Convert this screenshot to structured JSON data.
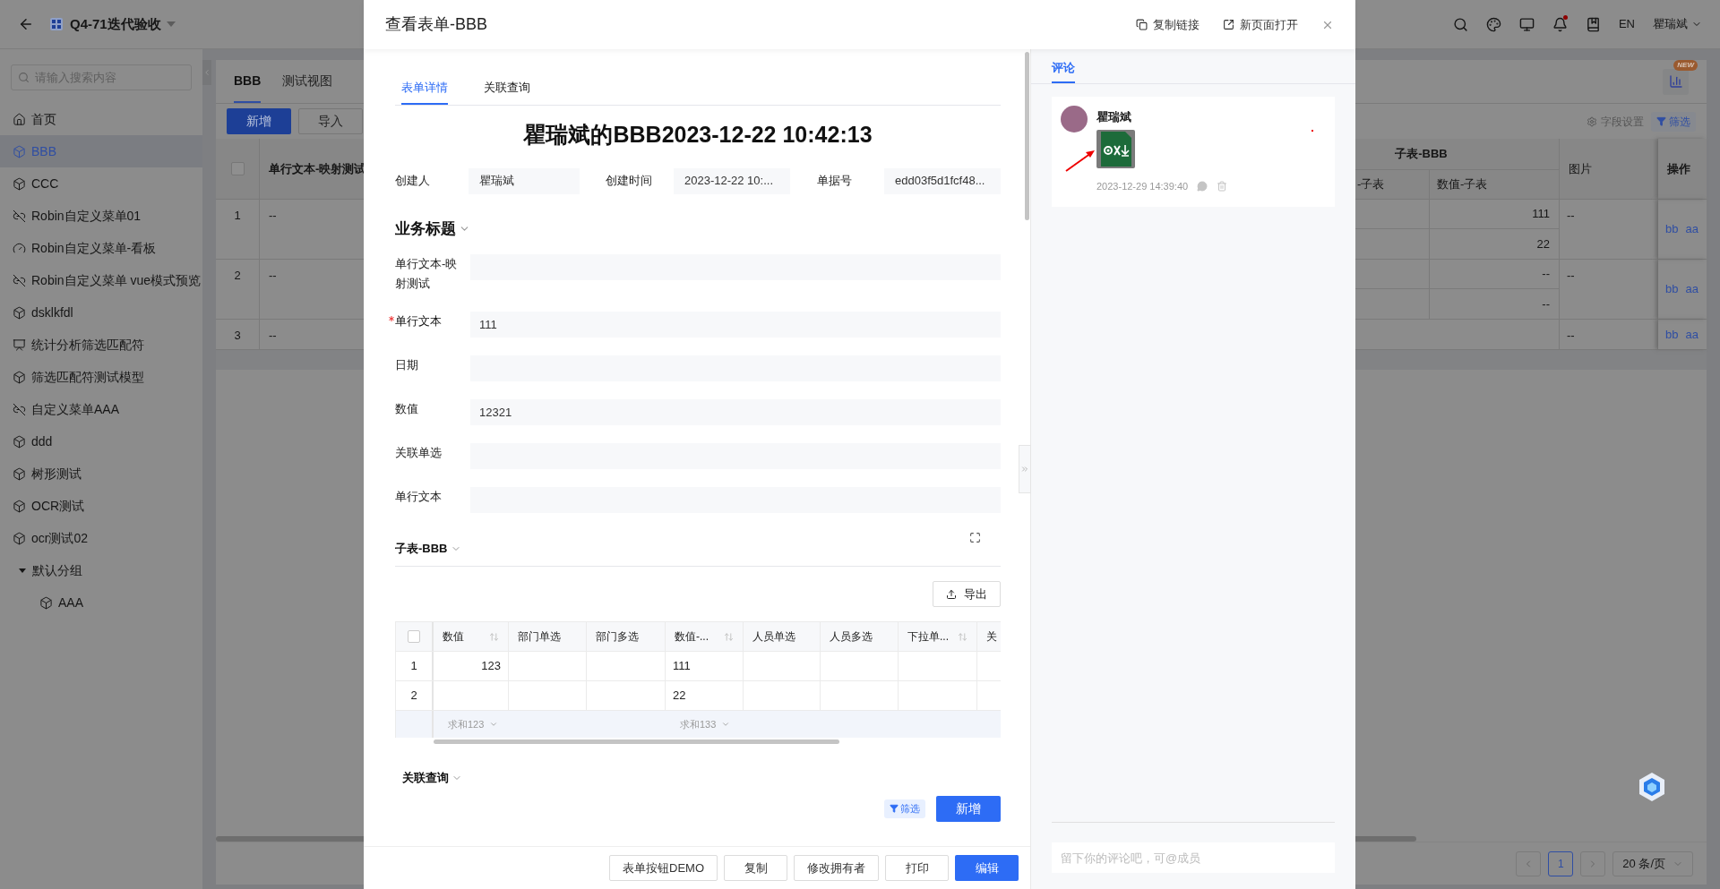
{
  "topbar": {
    "app_name": "Q4-71迭代验收",
    "notifications_unread": true,
    "language": "EN",
    "user": "瞿瑞斌"
  },
  "sidebar": {
    "search_placeholder": "请输入搜索内容",
    "items": [
      {
        "label": "首页",
        "kind": "home",
        "selected": false
      },
      {
        "label": "BBB",
        "kind": "model",
        "selected": true
      },
      {
        "label": "CCC",
        "kind": "model",
        "selected": false
      },
      {
        "label": "Robin自定义菜单01",
        "kind": "link",
        "selected": false
      },
      {
        "label": "Robin自定义菜单-看板",
        "kind": "dashboard",
        "selected": false
      },
      {
        "label": "Robin自定义菜单 vue模式预览",
        "kind": "link",
        "selected": false
      },
      {
        "label": "dsklkfdl",
        "kind": "model",
        "selected": false
      },
      {
        "label": "统计分析筛选匹配符",
        "kind": "chart",
        "selected": false
      },
      {
        "label": "筛选匹配符测试模型",
        "kind": "model",
        "selected": false
      },
      {
        "label": "自定义菜单AAA",
        "kind": "link",
        "selected": false
      },
      {
        "label": "ddd",
        "kind": "model",
        "selected": false
      },
      {
        "label": "树形测试",
        "kind": "model",
        "selected": false
      },
      {
        "label": "OCR测试",
        "kind": "model",
        "selected": false
      },
      {
        "label": "ocr测试02",
        "kind": "model",
        "selected": false
      },
      {
        "label": "默认分组",
        "kind": "group",
        "selected": false,
        "expanded": true,
        "children": [
          {
            "label": "AAA",
            "kind": "model",
            "selected": false
          }
        ]
      }
    ]
  },
  "view_tabs": [
    {
      "label": "BBB",
      "selected": true
    },
    {
      "label": "测试视图",
      "selected": false
    }
  ],
  "toolbar": {
    "buttons": [
      "新增",
      "导入"
    ],
    "new_badge": "NEW",
    "field_settings": "字段设置",
    "filter": "筛选"
  },
  "table": {
    "select_all_checked": false,
    "column_1": "单行文本-映射测试",
    "group_header": "子表-BBB",
    "sub_columns": [
      "-子表",
      "数值-子表"
    ],
    "image_column": "图片",
    "actions_column": "操作",
    "rows": [
      {
        "index": "1",
        "column_1": "--",
        "sub_rows": [
          {
            "value": "111"
          },
          {
            "value": "22"
          }
        ],
        "image": "--",
        "actions": [
          "bb",
          "aa"
        ]
      },
      {
        "index": "2",
        "column_1": "--",
        "sub_rows": [
          {
            "value": "--"
          },
          {
            "value": "--"
          }
        ],
        "image": "--",
        "actions": [
          "bb",
          "aa"
        ]
      },
      {
        "index": "3",
        "column_1": "--",
        "image": "--",
        "actions": [
          "bb",
          "aa"
        ]
      }
    ]
  },
  "pagination": {
    "pages": [
      {
        "label": "1",
        "selected": true
      }
    ],
    "page_size": "20 条/页"
  },
  "modal": {
    "title": "查看表单-BBB",
    "actions": [
      "复制链接",
      "新页面打开"
    ],
    "tabs": [
      {
        "label": "表单详情",
        "selected": true
      },
      {
        "label": "关联查询",
        "selected": false
      }
    ],
    "record_title": "瞿瑞斌的BBB2023-12-22 10:42:13",
    "meta": [
      {
        "label": "创建人",
        "value": "瞿瑞斌"
      },
      {
        "label": "创建时间",
        "value": "2023-12-22 10:..."
      },
      {
        "label": "单据号",
        "value": "edd03f5d1fcf48..."
      }
    ],
    "section_title": "业务标题",
    "fields": [
      {
        "label": "单行文本-映射测试",
        "required": false
      },
      {
        "label": "单行文本",
        "required": true,
        "value": "111"
      },
      {
        "label": "日期",
        "required": false
      },
      {
        "label": "数值",
        "required": false,
        "value": "12321"
      },
      {
        "label": "关联单选",
        "required": false
      },
      {
        "label": "单行文本",
        "required": false
      }
    ],
    "subtable": {
      "title": "子表-BBB",
      "export": "导出",
      "select_all_checked": false,
      "columns": [
        {
          "label": "数值",
          "sortable": true
        },
        {
          "label": "部门单选",
          "sortable": false
        },
        {
          "label": "部门多选",
          "sortable": false
        },
        {
          "label": "数值-...",
          "sortable": true
        },
        {
          "label": "人员单选",
          "sortable": false
        },
        {
          "label": "人员多选",
          "sortable": false
        },
        {
          "label": "下拉单...",
          "sortable": true
        },
        {
          "label": "关"
        }
      ],
      "rows": [
        {
          "index": "1",
          "column_1": "123",
          "column_4": "111"
        },
        {
          "index": "2",
          "column_4": "22"
        }
      ],
      "summary": {
        "column_1": "求和123",
        "column_4": "求和133"
      }
    },
    "related": {
      "title": "关联查询",
      "filter": "筛选",
      "add": "新增"
    },
    "footer_buttons": [
      {
        "label": "表单按钮DEMO",
        "primary": false
      },
      {
        "label": "复制",
        "primary": false
      },
      {
        "label": "修改拥有者",
        "primary": false
      },
      {
        "label": "打印",
        "primary": false
      },
      {
        "label": "编辑",
        "primary": true
      }
    ]
  },
  "comments_panel": {
    "tabs": [
      {
        "label": "评论",
        "selected": true
      }
    ],
    "comments": [
      {
        "author": "瞿瑞斌",
        "has_attachment": true,
        "time": "2023-12-29 14:39:40"
      }
    ],
    "input_placeholder": "留下你的评论吧，可@成员"
  }
}
